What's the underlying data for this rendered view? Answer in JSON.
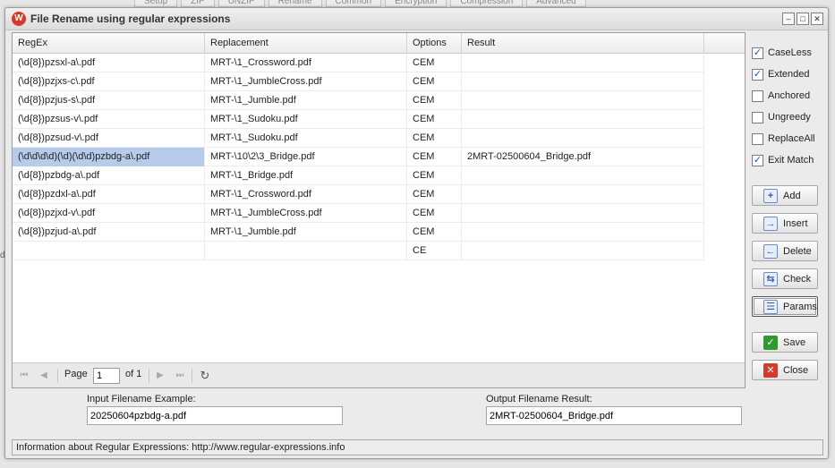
{
  "background": {
    "tabs": [
      "Setup",
      "ZIP",
      "UNZIP",
      "Rename",
      "Common",
      "Encryption",
      "Compression",
      "Advanced"
    ],
    "left_char": "d"
  },
  "dialog": {
    "title": "File Rename using regular expressions",
    "app_icon_letter": "W"
  },
  "grid": {
    "columns": [
      "RegEx",
      "Replacement",
      "Options",
      "Result"
    ],
    "rows": [
      {
        "regex": "(\\d{8})pzsxl-a\\.pdf",
        "replacement": "MRT-\\1_Crossword.pdf",
        "options": "CEM",
        "result": ""
      },
      {
        "regex": "(\\d{8})pzjxs-c\\.pdf",
        "replacement": "MRT-\\1_JumbleCross.pdf",
        "options": "CEM",
        "result": ""
      },
      {
        "regex": "(\\d{8})pzjus-s\\.pdf",
        "replacement": "MRT-\\1_Jumble.pdf",
        "options": "CEM",
        "result": ""
      },
      {
        "regex": "(\\d{8})pzsus-v\\.pdf",
        "replacement": "MRT-\\1_Sudoku.pdf",
        "options": "CEM",
        "result": ""
      },
      {
        "regex": "(\\d{8})pzsud-v\\.pdf",
        "replacement": "MRT-\\1_Sudoku.pdf",
        "options": "CEM",
        "result": ""
      },
      {
        "regex": "(\\d\\d\\d\\d)(\\d)(\\d\\d)pzbdg-a\\.pdf",
        "replacement": "MRT-\\10\\2\\3_Bridge.pdf",
        "options": "CEM",
        "result": "2MRT-02500604_Bridge.pdf",
        "selected": true
      },
      {
        "regex": "(\\d{8})pzbdg-a\\.pdf",
        "replacement": "MRT-\\1_Bridge.pdf",
        "options": "CEM",
        "result": ""
      },
      {
        "regex": "(\\d{8})pzdxl-a\\.pdf",
        "replacement": "MRT-\\1_Crossword.pdf",
        "options": "CEM",
        "result": ""
      },
      {
        "regex": "(\\d{8})pzjxd-v\\.pdf",
        "replacement": "MRT-\\1_JumbleCross.pdf",
        "options": "CEM",
        "result": ""
      },
      {
        "regex": "(\\d{8})pzjud-a\\.pdf",
        "replacement": "MRT-\\1_Jumble.pdf",
        "options": "CEM",
        "result": ""
      },
      {
        "regex": "",
        "replacement": "",
        "options": "CE",
        "result": ""
      }
    ],
    "pager": {
      "page_label": "Page",
      "page_value": "1",
      "of_label": "of 1"
    }
  },
  "options": [
    {
      "label": "CaseLess",
      "checked": true
    },
    {
      "label": "Extended",
      "checked": true
    },
    {
      "label": "Anchored",
      "checked": false
    },
    {
      "label": "Ungreedy",
      "checked": false
    },
    {
      "label": "ReplaceAll",
      "checked": false
    },
    {
      "label": "Exit Match",
      "checked": true
    }
  ],
  "buttons": {
    "add": "Add",
    "insert": "Insert",
    "delete": "Delete",
    "check": "Check",
    "params": "Params",
    "save": "Save",
    "close": "Close"
  },
  "fields": {
    "input_label": "Input Filename Example:",
    "input_value": "20250604pzbdg-a.pdf",
    "output_label": "Output Filename Result:",
    "output_value": "2MRT-02500604_Bridge.pdf"
  },
  "status": "Information about Regular Expressions: http://www.regular-expressions.info"
}
